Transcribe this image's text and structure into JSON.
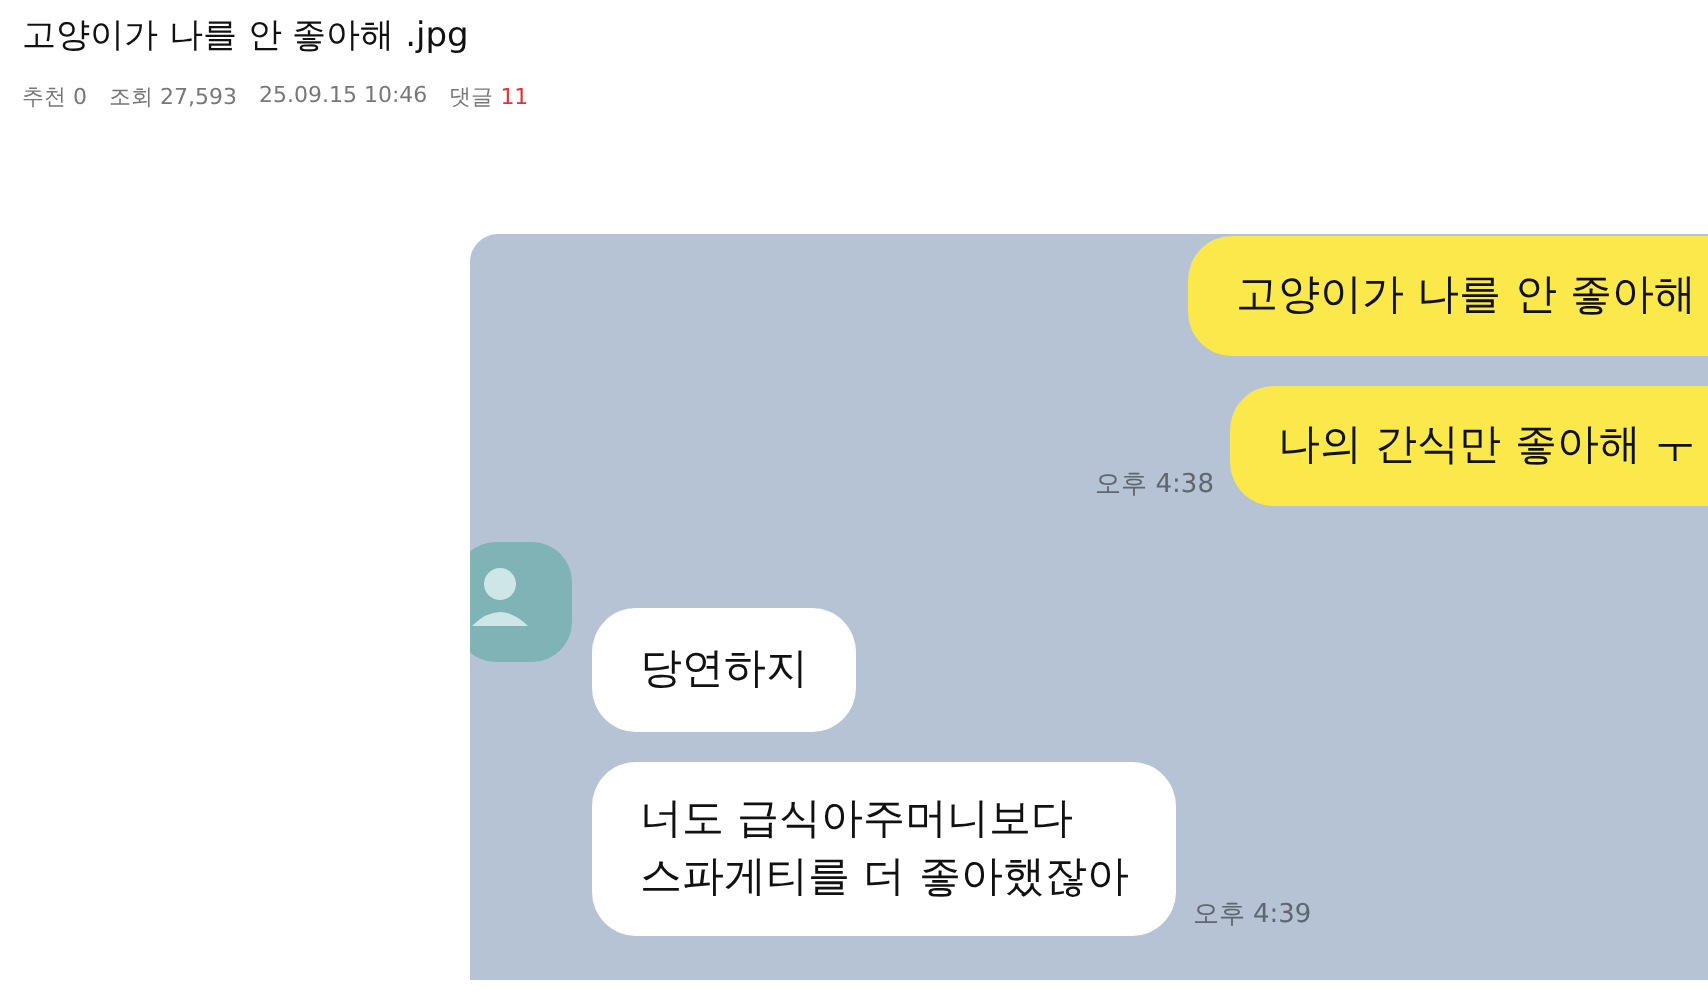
{
  "post": {
    "title": "고양이가 나를 안 좋아해 .jpg",
    "meta": [
      {
        "label": "추천",
        "value": "0",
        "highlight": false
      },
      {
        "label": "조회",
        "value": "27,593",
        "highlight": false
      },
      {
        "value": "25.09.15 10:46",
        "highlight": false
      },
      {
        "label": "댓글",
        "value": "11",
        "highlight": true
      }
    ]
  },
  "chat": {
    "messages": [
      {
        "kind": "sent",
        "text": "고양이가 나를 안 좋아해"
      },
      {
        "kind": "sent",
        "text": "나의 간식만 좋아해 ㅜ",
        "time": "오후 4:38"
      },
      {
        "kind": "received",
        "text": "당연하지"
      },
      {
        "kind": "received",
        "text": "너도 급식아주머니보다\n스파게티를 더 좋아했잖아",
        "time": "오후 4:39"
      }
    ]
  }
}
